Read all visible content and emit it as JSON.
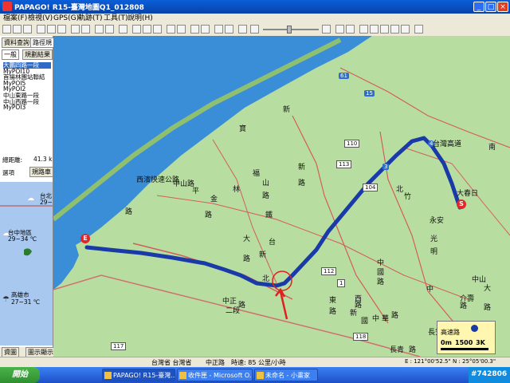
{
  "window": {
    "title": "PAPAGO! R15-臺灣地圖Q1_012808"
  },
  "menu": [
    "檔案(F)",
    "檢視(V)",
    "GPS(G)",
    "軌跡(T)",
    "工具(T)",
    "說明(H)"
  ],
  "panel": {
    "tabs": [
      "資料查詢",
      "路徑規",
      "一般",
      "規劃結果"
    ],
    "list": [
      "大鵬四路一段",
      "MyPOI10",
      "首揚林園站聯結",
      "MyPOI5",
      "MyPOI2",
      "中山東路一段",
      "中山西路一段",
      "MyPOI3"
    ],
    "total_label": "總距離:",
    "total_value": "41.3 k",
    "option_label": "選項",
    "route_button": "規路車"
  },
  "weather": {
    "items": [
      {
        "city": "台北",
        "temp": "29~",
        "icon": "cloud-icon"
      },
      {
        "city": "台中地區",
        "temp": "29~34 ℃",
        "icon": "cloud-icon"
      },
      {
        "city": "高雄市",
        "temp": "27~31 ℃",
        "icon": "rain-icon"
      }
    ]
  },
  "bottom_tabs": [
    "資圖",
    "圖示顯示"
  ],
  "map": {
    "route_color": "#1a3aa8",
    "land_color": "#b7dea0",
    "sea_color": "#3a8ed8",
    "labels": [
      "台灣高道",
      "大春日",
      "永安",
      "竹",
      "北",
      "西濱快速公路",
      "中山路",
      "路",
      "平",
      "金",
      "林",
      "路",
      "寶",
      "新",
      "福",
      "山",
      "路",
      "鐵",
      "大",
      "路",
      "新",
      "北",
      "台",
      "新",
      "路",
      "中正",
      "路",
      "二段",
      "中",
      "國",
      "路",
      "西",
      "路",
      "新",
      "國",
      "中",
      "華",
      "路",
      "東",
      "路",
      "中",
      "長安",
      "路",
      "光",
      "明",
      "中山",
      "大",
      "路",
      "介壽",
      "路",
      "長青",
      "路",
      "南"
    ],
    "shields": [
      "61",
      "15",
      "1",
      "110",
      "113",
      "104",
      "3",
      "112",
      "117",
      "118",
      "4"
    ],
    "markers": {
      "start": "S",
      "end": "E"
    },
    "scale": {
      "title": "高速路",
      "distance": "0m",
      "zoom": "1500",
      "scale_end": "3K"
    }
  },
  "status": {
    "location": "台灣省 台灣省",
    "road": "中正路",
    "speed": "時速: 85 公里/小時",
    "coords": "E : 121°00'52.5\"  N : 25°05'00.3\""
  },
  "taskbar": {
    "start": "開始",
    "tasks": [
      "PAPAGO! R15-臺灣...",
      "收件匣 - Microsoft O...",
      "未命名 - 小畫家"
    ],
    "tag": "#742806"
  }
}
